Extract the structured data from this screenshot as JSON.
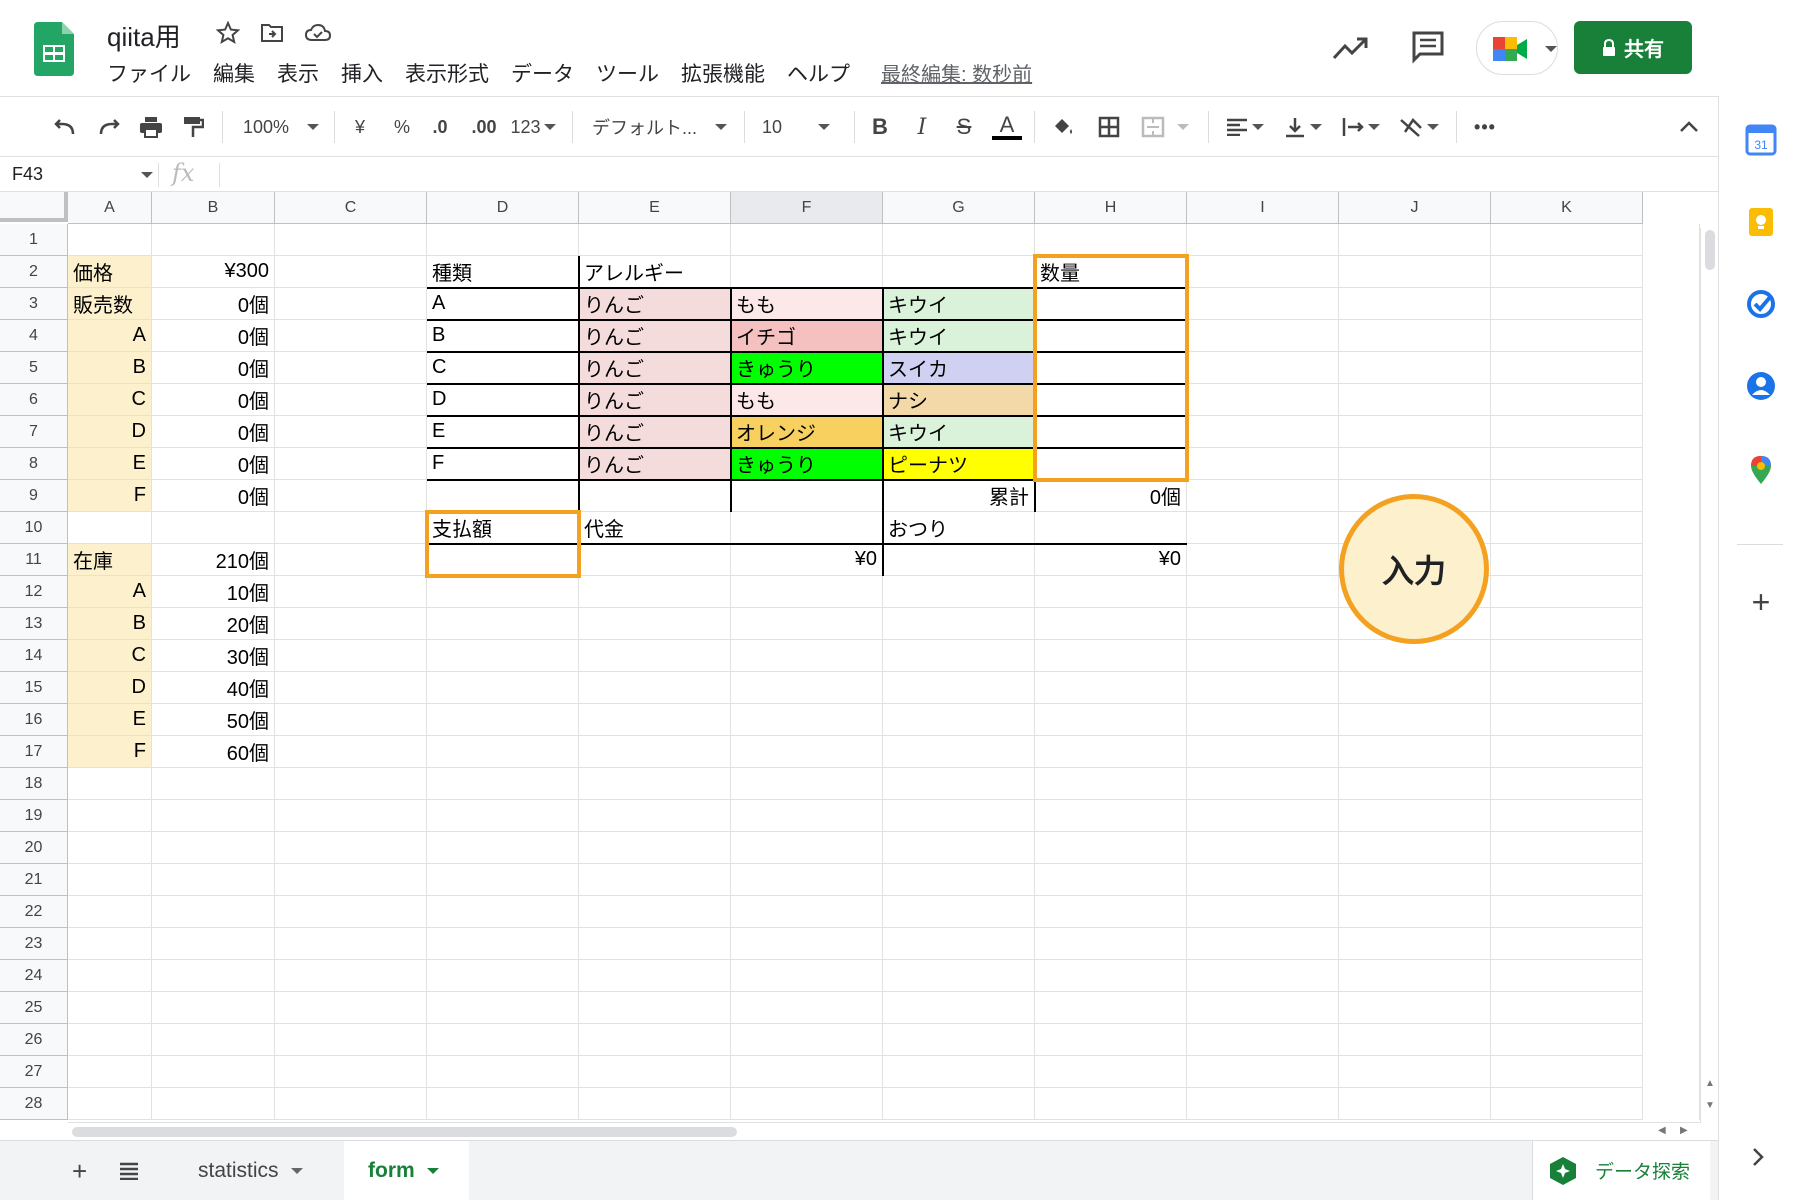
{
  "app": {
    "doc_title": "qiita用",
    "menu": [
      "ファイル",
      "編集",
      "表示",
      "挿入",
      "表示形式",
      "データ",
      "ツール",
      "拡張機能",
      "ヘルプ"
    ],
    "last_edit": "最終編集: 数秒前",
    "share_label": "共有",
    "accent_color": "#188038"
  },
  "toolbar": {
    "zoom": "100%",
    "currency": "¥",
    "percent": "%",
    "dec_decrease": ".0",
    "dec_increase": ".00",
    "number_format": "123",
    "font": "デフォルト...",
    "font_size": "10"
  },
  "formula_bar": {
    "cell_ref": "F43",
    "fx_label": "fx",
    "content": ""
  },
  "columns": [
    "A",
    "B",
    "C",
    "D",
    "E",
    "F",
    "G",
    "H",
    "I",
    "J",
    "K"
  ],
  "selected_column": "F",
  "rows": [
    "1",
    "2",
    "3",
    "4",
    "5",
    "6",
    "7",
    "8",
    "9",
    "10",
    "11",
    "12",
    "13",
    "14",
    "15",
    "16",
    "17",
    "18",
    "19",
    "20",
    "21",
    "22",
    "23",
    "24",
    "25",
    "26",
    "27",
    "28"
  ],
  "left_table": {
    "price_label": "価格",
    "price_value": "¥300",
    "sold_label": "販売数",
    "sold_value": "0個",
    "sold_rows": [
      {
        "type": "A",
        "count": "0個"
      },
      {
        "type": "B",
        "count": "0個"
      },
      {
        "type": "C",
        "count": "0個"
      },
      {
        "type": "D",
        "count": "0個"
      },
      {
        "type": "E",
        "count": "0個"
      },
      {
        "type": "F",
        "count": "0個"
      }
    ],
    "stock_label": "在庫",
    "stock_value": "210個",
    "stock_rows": [
      {
        "type": "A",
        "count": "10個"
      },
      {
        "type": "B",
        "count": "20個"
      },
      {
        "type": "C",
        "count": "30個"
      },
      {
        "type": "D",
        "count": "40個"
      },
      {
        "type": "E",
        "count": "50個"
      },
      {
        "type": "F",
        "count": "60個"
      }
    ],
    "label_bg": "#fdf0cc"
  },
  "order_table": {
    "header_type": "種類",
    "header_allergy": "アレルギー",
    "header_qty": "数量",
    "rows": [
      {
        "type": "A",
        "a1": "りんご",
        "a2": "もも",
        "a3": "キウイ",
        "qty": ""
      },
      {
        "type": "B",
        "a1": "りんご",
        "a2": "イチゴ",
        "a3": "キウイ",
        "qty": ""
      },
      {
        "type": "C",
        "a1": "りんご",
        "a2": "きゅうり",
        "a3": "スイカ",
        "qty": ""
      },
      {
        "type": "D",
        "a1": "りんご",
        "a2": "もも",
        "a3": "ナシ",
        "qty": ""
      },
      {
        "type": "E",
        "a1": "りんご",
        "a2": "オレンジ",
        "a3": "キウイ",
        "qty": ""
      },
      {
        "type": "F",
        "a1": "りんご",
        "a2": "きゅうり",
        "a3": "ピーナツ",
        "qty": ""
      }
    ],
    "total_label": "累計",
    "total_value": "0個",
    "pay_label": "支払額",
    "pay_value": "",
    "price_label": "代金",
    "price_value": "¥0",
    "change_label": "おつり",
    "change_value": "¥0",
    "colors": {
      "apple": "#f4dcdc",
      "peach": "#fce8e8",
      "strawberry": "#f4c0c0",
      "cucumber": "#00ff00",
      "kiwi": "#d9f2d9",
      "watermelon": "#d0d0f2",
      "pear": "#f4d9a8",
      "orange": "#f7d060",
      "peanut": "#ffff00",
      "highlight": "#f4a020"
    }
  },
  "callout": "入力",
  "sheet_tabs": [
    {
      "label": "statistics",
      "active": false
    },
    {
      "label": "form",
      "active": true
    }
  ],
  "explore_label": "データ探索"
}
